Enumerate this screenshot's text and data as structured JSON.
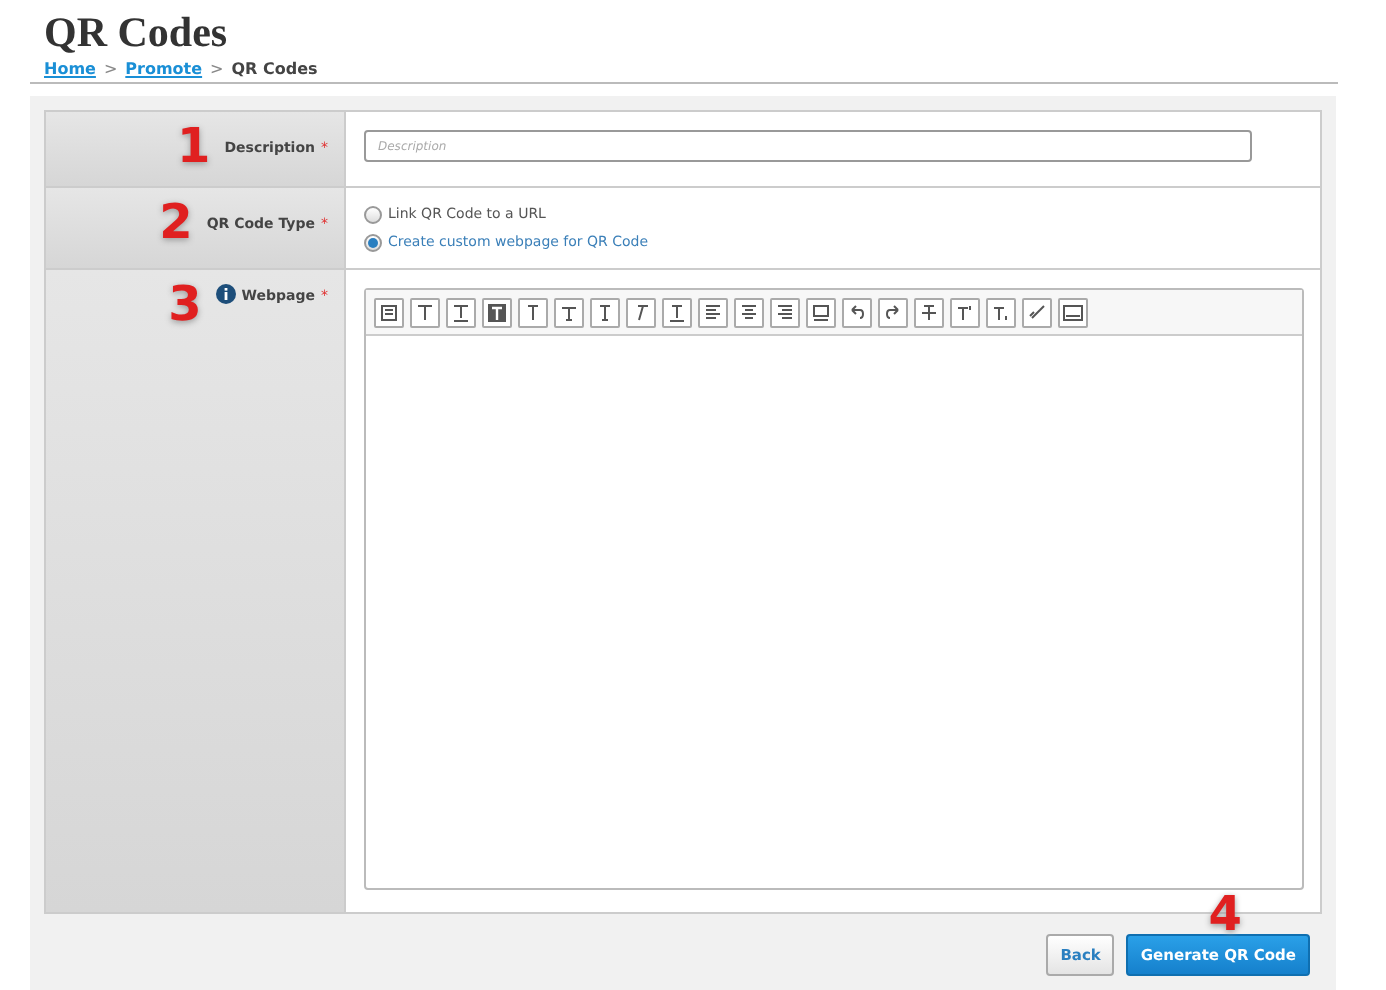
{
  "page": {
    "title": "QR Codes"
  },
  "breadcrumb": [
    {
      "label": "Home",
      "link": true
    },
    {
      "label": ">",
      "link": false
    },
    {
      "label": "Promote",
      "link": true
    },
    {
      "label": ">",
      "link": false
    },
    {
      "label": "QR Codes",
      "link": false
    }
  ],
  "form": {
    "rows": [
      {
        "kind": "text",
        "step": "1",
        "label": "Description",
        "required_mark": "*",
        "placeholder": "Description"
      },
      {
        "kind": "radio",
        "step": "2",
        "label": "QR Code Type",
        "required_mark": "*",
        "options": [
          {
            "label": "Link QR Code to a URL",
            "selected": false
          },
          {
            "label": "Create custom webpage for QR Code",
            "selected": true
          }
        ]
      },
      {
        "kind": "editor",
        "step": "3",
        "label": "Webpage",
        "required_mark": "*",
        "info": true
      }
    ]
  },
  "footer": {
    "step": "4",
    "buttons": [
      {
        "label": "Back",
        "kind": "secondary"
      },
      {
        "label": "Generate QR Code",
        "kind": "primary"
      }
    ]
  }
}
